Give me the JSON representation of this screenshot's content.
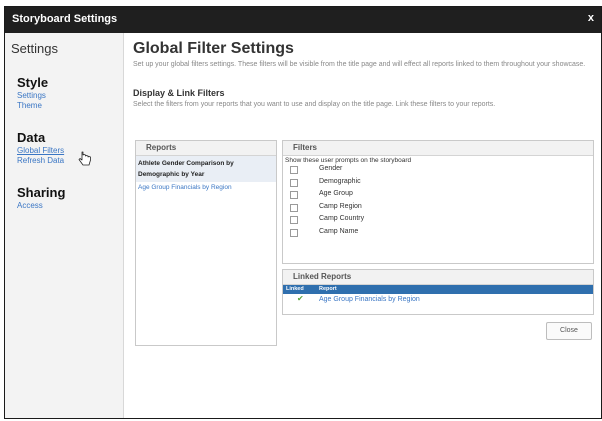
{
  "window": {
    "title": "Storyboard Settings",
    "close_glyph": "x"
  },
  "sidebar": {
    "heading": "Settings",
    "groups": [
      {
        "title": "Style",
        "items": [
          "Settings",
          "Theme"
        ]
      },
      {
        "title": "Data",
        "items": [
          "Global Filters",
          "Refresh Data"
        ]
      },
      {
        "title": "Sharing",
        "items": [
          "Access"
        ]
      }
    ]
  },
  "main": {
    "title": "Global Filter Settings",
    "description": "Set up your global filters settings. These filters will be visible from the title page and will effect all reports linked to them throughout your showcase.",
    "section_title": "Display & Link Filters",
    "section_description": "Select the filters from your reports that you want to use and display on the title page. Link these filters to your reports."
  },
  "reports_panel": {
    "header": "Reports",
    "items": [
      {
        "label": "Athlete Gender Comparison by Demographic by Year",
        "selected": true
      },
      {
        "label": "Age Group Financials by Region",
        "selected": false
      }
    ]
  },
  "filters_panel": {
    "header": "Filters",
    "prompt": "Show these user prompts on the storyboard",
    "items": [
      "Gender",
      "Demographic",
      "Age Group",
      "Camp Region",
      "Camp Country",
      "Camp Name"
    ]
  },
  "linked_reports": {
    "header": "Linked Reports",
    "col_linked": "Linked",
    "col_report": "Report",
    "rows": [
      {
        "linked": true,
        "report": "Age Group Financials by Region"
      }
    ]
  },
  "buttons": {
    "close_label": "Close"
  },
  "colors": {
    "titlebar": "#1f1f1f",
    "link": "#3a76c4",
    "table_header": "#2f6fae",
    "check": "#5aa33c"
  }
}
